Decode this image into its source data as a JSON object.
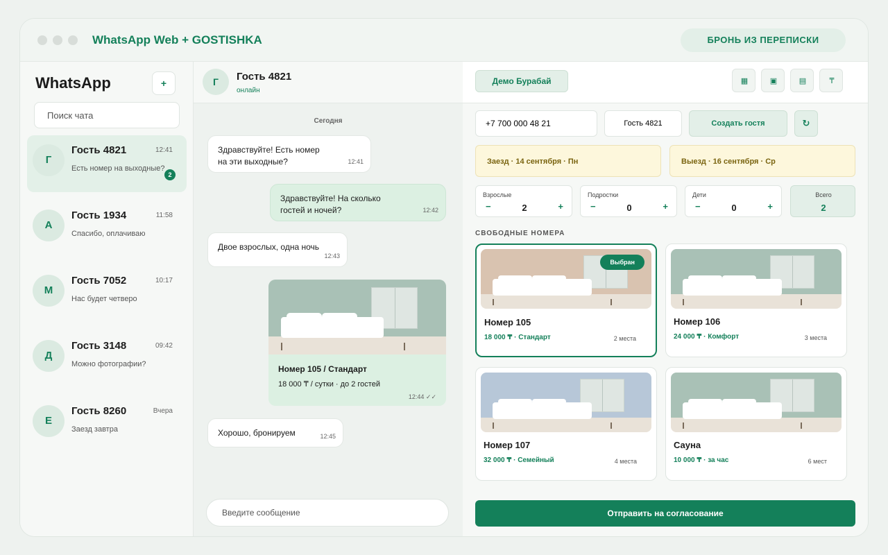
{
  "window": {
    "title": "WhatsApp Web + GOSTISHKA",
    "header_pill": "БРОНЬ ИЗ ПЕРЕПИСКИ"
  },
  "sidebar": {
    "brand": "WhatsApp",
    "new_chat_label": "+",
    "search_placeholder": "Поиск чата",
    "chats": [
      {
        "initial": "Г",
        "name": "Гость 4821",
        "time": "12:41",
        "last": "Есть номер на выходные?",
        "unread": "2"
      },
      {
        "initial": "А",
        "name": "Гость 1934",
        "time": "11:58",
        "last": "Спасибо, оплачиваю"
      },
      {
        "initial": "М",
        "name": "Гость 7052",
        "time": "10:17",
        "last": "Нас будет четверо"
      },
      {
        "initial": "Д",
        "name": "Гость 3148",
        "time": "09:42",
        "last": "Можно фотографии?"
      },
      {
        "initial": "Е",
        "name": "Гость 8260",
        "time": "Вчера",
        "last": "Заезд завтра"
      }
    ]
  },
  "conversation": {
    "avatar_initial": "Г",
    "name": "Гость 4821",
    "status": "онлайн",
    "day_label": "Сегодня",
    "messages": [
      {
        "line1": "Здравствуйте! Есть номер",
        "line2": "на эти выходные?",
        "time": "12:41"
      },
      {
        "line1": "Здравствуйте! На сколько",
        "line2": "гостей и ночей?",
        "time": "12:42"
      },
      {
        "line1": "Двое взрослых, одна ночь",
        "time": "12:43"
      },
      {
        "line1": "Хорошо, бронируем",
        "time": "12:45"
      }
    ],
    "card": {
      "title": "Номер 105 / Стандарт",
      "subtitle": "18 000 ₸ / сутки · до 2 гостей",
      "time": "12:44 ✓✓"
    },
    "composer_placeholder": "Введите сообщение"
  },
  "booking": {
    "property_label": "Демо Бурабай",
    "tools": [
      {
        "icon": "grid-icon",
        "glyph": "▦"
      },
      {
        "icon": "square-icon",
        "glyph": "▣"
      },
      {
        "icon": "list-icon",
        "glyph": "▤"
      },
      {
        "icon": "tenge-icon",
        "glyph": "₸"
      }
    ],
    "phone_value": "+7 700 000 48 21",
    "guest_value": "Гость 4821",
    "create_guest_label": "Создать гостя",
    "refresh_label": "↻",
    "checkin": "Заезд · 14 сентября · Пн",
    "checkout": "Выезд · 16 сентября · Ср",
    "counters": [
      {
        "label": "Взрослые",
        "minus": "−",
        "value": "2",
        "plus": "+"
      },
      {
        "label": "Подростки",
        "minus": "−",
        "value": "0",
        "plus": "+"
      },
      {
        "label": "Дети",
        "minus": "−",
        "value": "0",
        "plus": "+"
      }
    ],
    "total": {
      "label": "Всего",
      "value": "2"
    },
    "rooms_title": "СВОБОДНЫЕ НОМЕРА",
    "rooms": [
      {
        "name": "Номер 105",
        "price": "18 000 ₸ · Стандарт",
        "capacity": "2 места",
        "selected_label": "Выбран",
        "wall": "#d9c3b0"
      },
      {
        "name": "Номер 106",
        "price": "24 000 ₸ · Комфорт",
        "capacity": "3 места",
        "wall": "#a9c1b6"
      },
      {
        "name": "Номер 107",
        "price": "32 000 ₸ · Семейный",
        "capacity": "4 места",
        "wall": "#b7c7d8"
      },
      {
        "name": "Сауна",
        "price": "10 000 ₸ · за час",
        "capacity": "6 мест",
        "wall": "#a9c1b6"
      }
    ],
    "submit_label": "Отправить на согласование"
  },
  "colors": {
    "accent": "#14805a",
    "accent_light": "#e3efe8",
    "date_bg": "#fdf7dc"
  }
}
